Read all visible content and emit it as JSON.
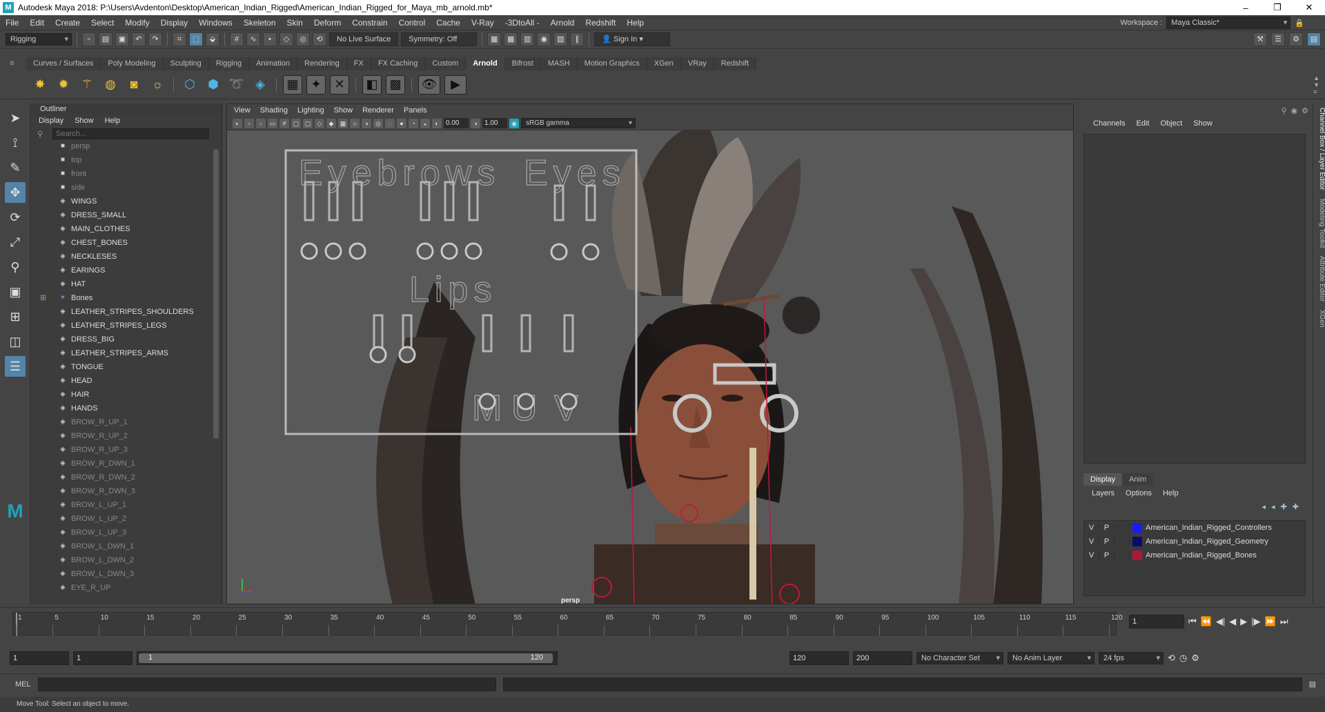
{
  "window": {
    "title": "Autodesk Maya 2018: P:\\Users\\Avdenton\\Desktop\\American_Indian_Rigged\\American_Indian_Rigged_for_Maya_mb_arnold.mb*",
    "min": "–",
    "max": "❐",
    "close": "✕"
  },
  "menu": [
    "File",
    "Edit",
    "Create",
    "Select",
    "Modify",
    "Display",
    "Windows",
    "Skeleton",
    "Skin",
    "Deform",
    "Constrain",
    "Control",
    "Cache",
    "V-Ray",
    "-3DtoAll -",
    "Arnold",
    "Redshift",
    "Help"
  ],
  "workspace": {
    "label": "Workspace :",
    "value": "Maya Classic*"
  },
  "status": {
    "mode": "Rigging",
    "live_surface": "No Live Surface",
    "symmetry": "Symmetry: Off",
    "sign_in": "Sign In"
  },
  "shelf_tabs": [
    "Curves / Surfaces",
    "Poly Modeling",
    "Sculpting",
    "Rigging",
    "Animation",
    "Rendering",
    "FX",
    "FX Caching",
    "Custom",
    "Arnold",
    "Bifrost",
    "MASH",
    "Motion Graphics",
    "XGen",
    "VRay",
    "Redshift"
  ],
  "active_shelf": "Arnold",
  "outliner": {
    "title": "Outliner",
    "menu": [
      "Display",
      "Show",
      "Help"
    ],
    "search_placeholder": "Search...",
    "items": [
      {
        "label": "persp",
        "icon": "camera-icon",
        "dim": true
      },
      {
        "label": "top",
        "icon": "camera-icon",
        "dim": true
      },
      {
        "label": "front",
        "icon": "camera-icon",
        "dim": true
      },
      {
        "label": "side",
        "icon": "camera-icon",
        "dim": true
      },
      {
        "label": "WINGS",
        "icon": "transform-icon"
      },
      {
        "label": "DRESS_SMALL",
        "icon": "transform-icon"
      },
      {
        "label": "MAIN_CLOTHES",
        "icon": "transform-icon"
      },
      {
        "label": "CHEST_BONES",
        "icon": "transform-icon"
      },
      {
        "label": "NECKLESES",
        "icon": "transform-icon"
      },
      {
        "label": "EARINGS",
        "icon": "transform-icon"
      },
      {
        "label": "HAT",
        "icon": "transform-icon"
      },
      {
        "label": "Bones",
        "icon": "joint-icon",
        "expand": true
      },
      {
        "label": "LEATHER_STRIPES_SHOULDERS",
        "icon": "transform-icon"
      },
      {
        "label": "LEATHER_STRIPES_LEGS",
        "icon": "transform-icon"
      },
      {
        "label": "DRESS_BIG",
        "icon": "transform-icon"
      },
      {
        "label": "LEATHER_STRIPES_ARMS",
        "icon": "transform-icon"
      },
      {
        "label": "TONGUE",
        "icon": "transform-icon"
      },
      {
        "label": "HEAD",
        "icon": "transform-icon"
      },
      {
        "label": "HAIR",
        "icon": "transform-icon"
      },
      {
        "label": "HANDS",
        "icon": "transform-icon"
      },
      {
        "label": "BROW_R_UP_1",
        "icon": "transform-icon",
        "dim": true
      },
      {
        "label": "BROW_R_UP_2",
        "icon": "transform-icon",
        "dim": true
      },
      {
        "label": "BROW_R_UP_3",
        "icon": "transform-icon",
        "dim": true
      },
      {
        "label": "BROW_R_DWN_1",
        "icon": "transform-icon",
        "dim": true
      },
      {
        "label": "BROW_R_DWN_2",
        "icon": "transform-icon",
        "dim": true
      },
      {
        "label": "BROW_R_DWN_3",
        "icon": "transform-icon",
        "dim": true
      },
      {
        "label": "BROW_L_UP_1",
        "icon": "transform-icon",
        "dim": true
      },
      {
        "label": "BROW_L_UP_2",
        "icon": "transform-icon",
        "dim": true
      },
      {
        "label": "BROW_L_UP_3",
        "icon": "transform-icon",
        "dim": true
      },
      {
        "label": "BROW_L_DWN_1",
        "icon": "transform-icon",
        "dim": true
      },
      {
        "label": "BROW_L_DWN_2",
        "icon": "transform-icon",
        "dim": true
      },
      {
        "label": "BROW_L_DWN_3",
        "icon": "transform-icon",
        "dim": true
      },
      {
        "label": "EYE_R_UP",
        "icon": "transform-icon",
        "dim": true
      }
    ]
  },
  "viewport": {
    "menu": [
      "View",
      "Shading",
      "Lighting",
      "Show",
      "Renderer",
      "Panels"
    ],
    "near": "0.00",
    "far": "1.00",
    "color_space": "sRGB gamma",
    "camera_label": "persp",
    "rig_labels": {
      "eyebrows": "Eyebrows",
      "eyes": "Eyes",
      "lips": "Lips",
      "m": "M",
      "u": "U",
      "v": "V"
    }
  },
  "channel_box": {
    "menu": [
      "Channels",
      "Edit",
      "Object",
      "Show"
    ],
    "side_tab": "Channel Box / Layer Editor"
  },
  "layer_editor": {
    "tabs": [
      "Display",
      "Anim"
    ],
    "active_tab": "Display",
    "menu": [
      "Layers",
      "Options",
      "Help"
    ],
    "layers": [
      {
        "v": "V",
        "p": "P",
        "name": "American_Indian_Rigged_Controllers",
        "color": "#1a1aff"
      },
      {
        "v": "V",
        "p": "P",
        "name": "American_Indian_Rigged_Geometry",
        "color": "#0b0b6e"
      },
      {
        "v": "V",
        "p": "P",
        "name": "American_Indian_Rigged_Bones",
        "color": "#b0163c"
      }
    ]
  },
  "side_tabs": [
    "Channel Box / Layer Editor",
    "Modeling Toolkit",
    "Attribute Editor",
    "XGen"
  ],
  "timeline": {
    "ticks": [
      "1",
      "5",
      "10",
      "15",
      "20",
      "25",
      "30",
      "35",
      "40",
      "45",
      "50",
      "55",
      "60",
      "65",
      "70",
      "75",
      "80",
      "85",
      "90",
      "95",
      "100",
      "105",
      "110",
      "115",
      "120"
    ],
    "current_frame": "1"
  },
  "range": {
    "start": "1",
    "playback_start": "1",
    "slider_start": "1",
    "slider_end": "120",
    "playback_end": "120",
    "end": "200",
    "character_set": "No Character Set",
    "anim_layer": "No Anim Layer",
    "fps": "24 fps"
  },
  "command_line": {
    "lang": "MEL"
  },
  "help_line": "Move Tool: Select an object to move."
}
